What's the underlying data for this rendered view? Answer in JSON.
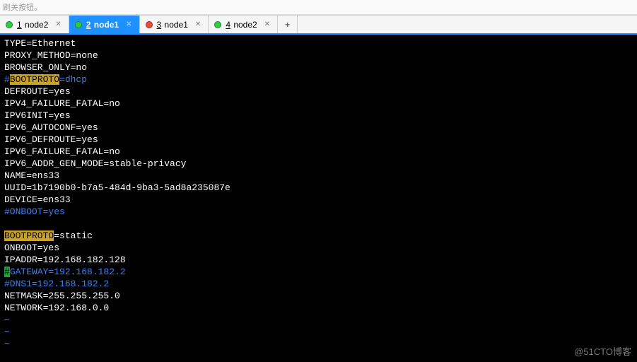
{
  "partial_header": "刷关按钮。",
  "tabs": [
    {
      "idx": "1",
      "label": "node2",
      "status": "green",
      "active": false
    },
    {
      "idx": "2",
      "label": "node1",
      "status": "green",
      "active": true
    },
    {
      "idx": "3",
      "label": "node1",
      "status": "red",
      "active": false
    },
    {
      "idx": "4",
      "label": "node2",
      "status": "green",
      "active": false
    }
  ],
  "add_tab_label": "+",
  "terminal_lines": [
    {
      "segments": [
        {
          "text": "TYPE=Ethernet"
        }
      ]
    },
    {
      "segments": [
        {
          "text": "PROXY_METHOD=none"
        }
      ]
    },
    {
      "segments": [
        {
          "text": "BROWSER_ONLY=no"
        }
      ]
    },
    {
      "segments": [
        {
          "text": "#",
          "cls": "blue"
        },
        {
          "text": "BOOTPROTO",
          "cls": "hl-yellow"
        },
        {
          "text": "=dhcp",
          "cls": "blue"
        }
      ]
    },
    {
      "segments": [
        {
          "text": "DEFROUTE=yes"
        }
      ]
    },
    {
      "segments": [
        {
          "text": "IPV4_FAILURE_FATAL=no"
        }
      ]
    },
    {
      "segments": [
        {
          "text": "IPV6INIT=yes"
        }
      ]
    },
    {
      "segments": [
        {
          "text": "IPV6_AUTOCONF=yes"
        }
      ]
    },
    {
      "segments": [
        {
          "text": "IPV6_DEFROUTE=yes"
        }
      ]
    },
    {
      "segments": [
        {
          "text": "IPV6_FAILURE_FATAL=no"
        }
      ]
    },
    {
      "segments": [
        {
          "text": "IPV6_ADDR_GEN_MODE=stable-privacy"
        }
      ]
    },
    {
      "segments": [
        {
          "text": "NAME=ens33"
        }
      ]
    },
    {
      "segments": [
        {
          "text": "UUID=1b7190b0-b7a5-484d-9ba3-5ad8a235087e"
        }
      ]
    },
    {
      "segments": [
        {
          "text": "DEVICE=ens33"
        }
      ]
    },
    {
      "segments": [
        {
          "text": "#ONBOOT=yes",
          "cls": "blue"
        }
      ]
    },
    {
      "segments": [
        {
          "text": " "
        }
      ]
    },
    {
      "segments": [
        {
          "text": "BOOTPROTO",
          "cls": "hl-yellow"
        },
        {
          "text": "=static"
        }
      ]
    },
    {
      "segments": [
        {
          "text": "ONBOOT=yes"
        }
      ]
    },
    {
      "segments": [
        {
          "text": "IPADDR=192.168.182.128"
        }
      ]
    },
    {
      "segments": [
        {
          "text": "#",
          "cls": "hl-green"
        },
        {
          "text": "GATEWAY=192.168.182.2",
          "cls": "blue"
        }
      ]
    },
    {
      "segments": [
        {
          "text": "#DNS1=192.168.182.2",
          "cls": "blue"
        }
      ]
    },
    {
      "segments": [
        {
          "text": "NETMASK=255.255.255.0"
        }
      ]
    },
    {
      "segments": [
        {
          "text": "NETWORK=192.168.0.0"
        }
      ]
    },
    {
      "segments": [
        {
          "text": "~",
          "cls": "blue"
        }
      ]
    },
    {
      "segments": [
        {
          "text": "~",
          "cls": "blue"
        }
      ]
    },
    {
      "segments": [
        {
          "text": "~",
          "cls": "blue"
        }
      ]
    }
  ],
  "watermark": "@51CTO博客"
}
